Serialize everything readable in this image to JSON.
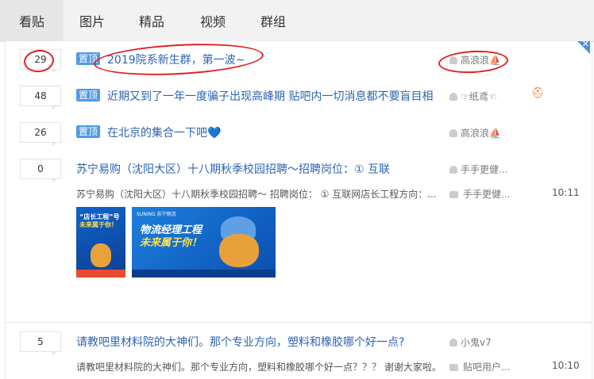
{
  "tabs": [
    "看贴",
    "图片",
    "精品",
    "视频",
    "群组"
  ],
  "pin_label": "置顶",
  "close_glyph": "✕",
  "threads": [
    {
      "replies": "29",
      "title": "2019院系新生群，第一波~",
      "author": "高浪浪",
      "author_badge": "⛵"
    },
    {
      "replies": "48",
      "title": "近期又到了一年一度骗子出现高峰期 贴吧内一切消息都不要盲目相",
      "author": "☞纸鸢☜",
      "extra_icon": "⛑"
    },
    {
      "replies": "26",
      "title": "在北京的集合一下吧💙",
      "author": "高浪浪",
      "author_badge": "⛵"
    },
    {
      "replies": "0",
      "title": "苏宁易购（沈阳大区）十八期秋季校园招聘～招聘岗位：① 互联",
      "author": "手手更健...",
      "snippet": "苏宁易购（沈阳大区）十八期秋季校园招聘～ 招聘岗位： ① 互联网店长工程方向：...",
      "last_replier": "手手更健...",
      "time": "10:11",
      "image1_text": [
        "“店长工程”号",
        "未来属于你！"
      ],
      "image2_brand": "SUNING 苏宁物流",
      "image2_text": [
        "物流经理工程",
        "未来属于你！"
      ]
    },
    {
      "replies": "5",
      "title": "请教吧里材料院的大神们。那个专业方向，塑料和橡胶哪个好一点?",
      "author": "小鬼v7",
      "snippet": "请教吧里材料院的大神们。那个专业方向，塑料和橡胶哪个好一点？？？ 谢谢大家啦。",
      "last_replier": "贴吧用户...",
      "time": "10:10"
    }
  ],
  "colors": {
    "link": "#2d64b3",
    "pin": "#4f9be5",
    "annotation": "#e02020"
  }
}
